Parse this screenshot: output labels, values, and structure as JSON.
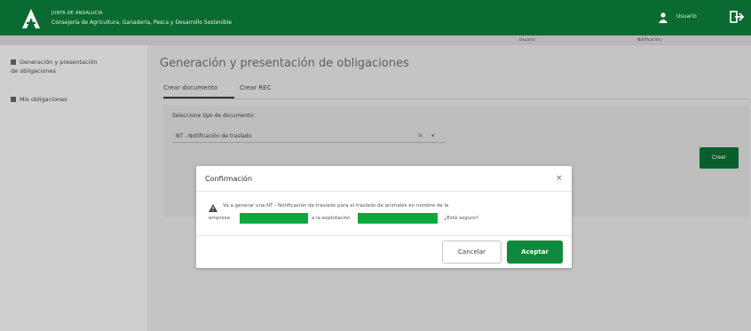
{
  "header": {
    "org_line1": "JUNTA DE ANDALUCÍA",
    "org_line2": "Consejería de Agricultura, Ganadería, Pesca y Desarrollo Sostenible",
    "user_name": "Usuario",
    "colors": {
      "brand": "#0a6b30"
    }
  },
  "subbar": {
    "seg1": "Usuario: ",
    "seg2": "Notificación: "
  },
  "sidebar": {
    "items": [
      {
        "label_line1": "Generación y presentación",
        "label_line2": "de obligaciones"
      },
      {
        "label_line1": "Mis obligaciones"
      }
    ]
  },
  "main": {
    "title": "Generación y presentación de obligaciones",
    "tabs": [
      {
        "label": "Crear documento"
      },
      {
        "label": "Crear REC"
      }
    ],
    "field_label": "Seleccione tipo de documento:",
    "select_value": "NT - Notificación de traslado",
    "background_button": "Crear"
  },
  "modal": {
    "title": "Confirmación",
    "close_glyph": "×",
    "message_line1": "Va a generar una NT - Notificación de traslado para el traslado de animales en nombre de la",
    "message_prefix": "empresa",
    "message_middle": "a la explotación",
    "message_suffix": ". ¿Está seguro?",
    "cancel_label": "Cancelar",
    "confirm_label": "Aceptar",
    "colors": {
      "confirm": "#0f8a3c",
      "redaction": "#0aa93e"
    }
  }
}
